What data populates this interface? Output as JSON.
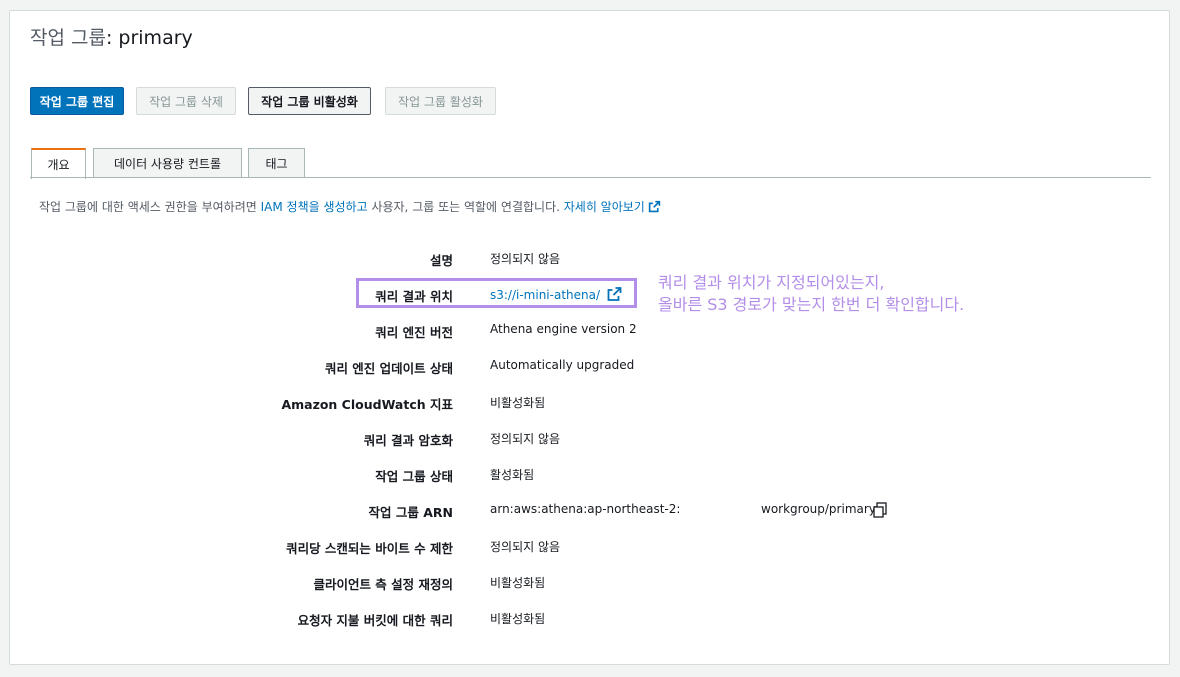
{
  "page": {
    "title_prefix": "작업 그룹",
    "title_name": ": primary"
  },
  "actions": {
    "edit": "작업 그룹 편집",
    "delete": "작업 그룹 삭제",
    "disable": "작업 그룹 비활성화",
    "enable": "작업 그룹 활성화"
  },
  "tabs": [
    "개요",
    "데이터 사용량 컨트롤",
    "태그"
  ],
  "info": {
    "text_before": "작업 그룹에 대한 액세스 권한을 부여하려면 ",
    "link_policy": "IAM 정책을 생성하고",
    "text_after": " 사용자, 그룹 또는 역할에 연결합니다. ",
    "link_learn": "자세히 알아보기"
  },
  "details": [
    {
      "label": "설명",
      "value": "정의되지 않음"
    },
    {
      "label": "쿼리 결과 위치",
      "value": "s3://i-mini-athena/"
    },
    {
      "label": "쿼리 엔진 버전",
      "value": "Athena engine version 2"
    },
    {
      "label": "쿼리 엔진 업데이트 상태",
      "value": "Automatically upgraded"
    },
    {
      "label": "Amazon CloudWatch 지표",
      "value": "비활성화됨"
    },
    {
      "label": "쿼리 결과 암호화",
      "value": "정의되지 않음"
    },
    {
      "label": "작업 그룹 상태",
      "value": "활성화됨"
    },
    {
      "label": "작업 그룹 ARN",
      "value": "arn:aws:athena:ap-northeast-2:",
      "value_tail": "workgroup/primary"
    },
    {
      "label": "쿼리당 스캔되는 바이트 수 제한",
      "value": "정의되지 않음"
    },
    {
      "label": "클라이언트 측 설정 재정의",
      "value": "비활성화됨"
    },
    {
      "label": "요청자 지불 버킷에 대한 쿼리",
      "value": "비활성화됨"
    }
  ],
  "annotation": {
    "line1": "쿼리 결과 위치가 지정되어있는지,",
    "line2": "올바른 S3 경로가 맞는지 한번 더 확인합니다.",
    "color": "#b38ee8"
  },
  "colors": {
    "primary_button": "#0073bb",
    "link": "#0073bb",
    "active_tab_accent": "#ec7211"
  }
}
